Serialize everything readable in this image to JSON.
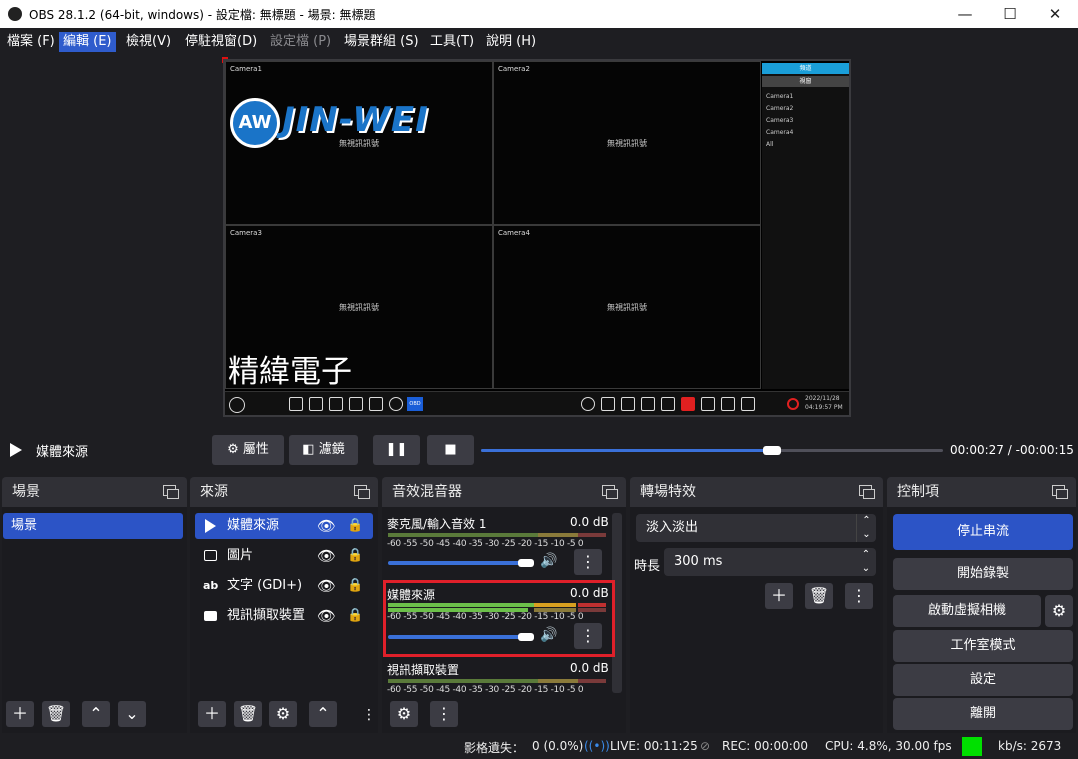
{
  "window": {
    "title": "OBS 28.1.2 (64-bit, windows) - 設定檔: 無標題 - 場景: 無標題",
    "min": "—",
    "max": "☐",
    "close": "✕"
  },
  "menu": [
    {
      "label": "檔案 (F)"
    },
    {
      "label": "編輯 (E)"
    },
    {
      "label": "檢視(V)"
    },
    {
      "label": "停駐視窗(D)"
    },
    {
      "label": "設定檔 (P)"
    },
    {
      "label": "場景群組 (S)"
    },
    {
      "label": "工具(T)"
    },
    {
      "label": "說明 (H)"
    }
  ],
  "preview": {
    "cameras": [
      "Camera1",
      "Camera2",
      "Camera3",
      "Camera4"
    ],
    "no_signal": "無視訊訊號",
    "logo_text": "JIN-WEI",
    "logo_mark": "AW",
    "overlay_text": "精緯電子",
    "side_header": "頻道",
    "side_sub": "視窗",
    "side_items": [
      "Camera1",
      "Camera2",
      "Camera3",
      "Camera4",
      "All"
    ],
    "nvr_date": "2022/11/28",
    "nvr_time": "04:19:57 PM",
    "obd_badge": "OBD"
  },
  "transport": {
    "media_name": "媒體來源",
    "properties": "屬性",
    "filters": "濾鏡",
    "time_current": "00:00:27",
    "time_sep": "/",
    "time_remaining": "-00:00:15",
    "progress": 0.63
  },
  "scenes": {
    "title": "場景",
    "items": [
      "場景"
    ]
  },
  "sources": {
    "title": "來源",
    "items": [
      {
        "label": "媒體來源",
        "icon": "play-icon",
        "selected": true
      },
      {
        "label": "圖片",
        "icon": "image-icon",
        "selected": false
      },
      {
        "label": "文字 (GDI+)",
        "icon": "text-icon",
        "selected": false
      },
      {
        "label": "視訊擷取裝置",
        "icon": "camera-icon",
        "selected": false
      }
    ]
  },
  "mixer": {
    "title": "音效混音器",
    "scale": "-60 -55 -50 -45 -40 -35 -30 -25 -20 -15 -10 -5 0",
    "channels": [
      {
        "name": "麥克風/輸入音效 1",
        "db": "0.0 dB",
        "volume": 0.95
      },
      {
        "name": "媒體來源",
        "db": "0.0 dB",
        "volume": 0.95,
        "highlighted": true
      },
      {
        "name": "視訊擷取裝置",
        "db": "0.0 dB",
        "volume": 0.95
      }
    ]
  },
  "transitions": {
    "title": "轉場特效",
    "selected": "淡入淡出",
    "duration_label": "時長",
    "duration_value": "300 ms"
  },
  "controls": {
    "title": "控制項",
    "stop_stream": "停止串流",
    "start_record": "開始錄製",
    "virtual_cam": "啟動虛擬相機",
    "studio_mode": "工作室模式",
    "settings": "設定",
    "exit": "離開"
  },
  "status": {
    "dropped_label": "影格遺失：",
    "dropped_value": "0 (0.0%)",
    "live": "LIVE: 00:11:25",
    "rec": "REC: 00:00:00",
    "cpu": "CPU: 4.8%, 30.00 fps",
    "kbps": "kb/s: 2673",
    "indicator_color": "#00e000"
  },
  "colors": {
    "accent": "#2c54c6",
    "highlight_box": "#e0202a"
  }
}
